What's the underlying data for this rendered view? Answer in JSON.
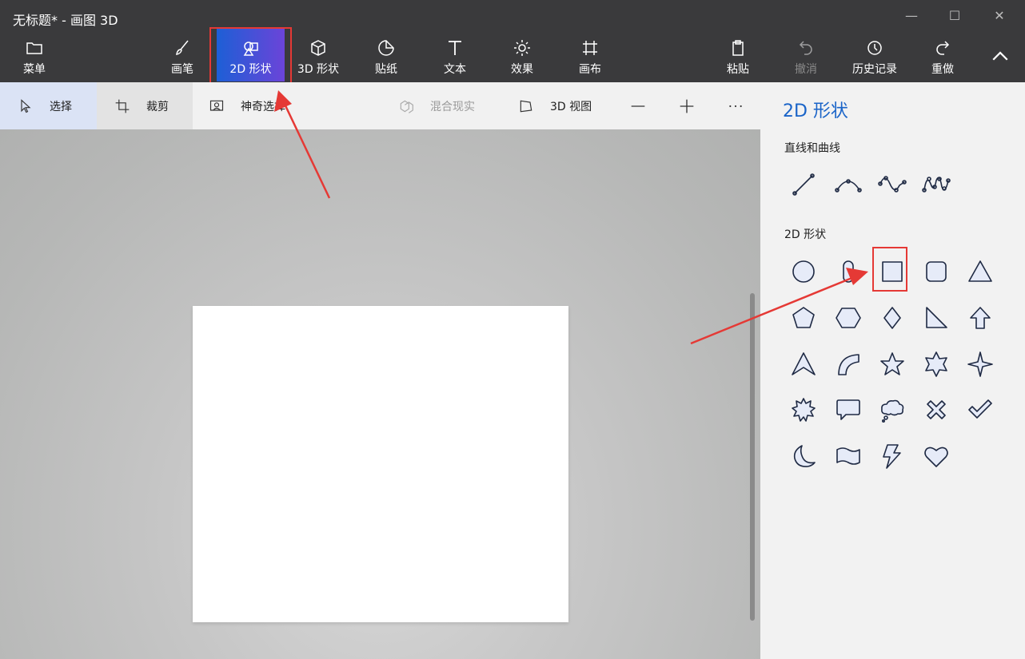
{
  "window": {
    "title": "无标题* - 画图 3D"
  },
  "ribbon": {
    "menu": "菜单",
    "brushes": "画笔",
    "shapes2d": "2D 形状",
    "shapes3d": "3D 形状",
    "stickers": "贴纸",
    "text": "文本",
    "effects": "效果",
    "canvas": "画布",
    "paste": "粘贴",
    "undo": "撤消",
    "history": "历史记录",
    "redo": "重做"
  },
  "toolbar": {
    "select": "选择",
    "crop": "裁剪",
    "magic_select": "神奇选择",
    "mixed_reality": "混合现实",
    "view3d": "3D 视图"
  },
  "panel": {
    "title": "2D 形状",
    "lines_section": "直线和曲线",
    "shapes_section": "2D 形状"
  },
  "colors": {
    "accent": "#1a64c8",
    "annotation": "#e53935",
    "ribbon_bg": "#3a3a3c"
  }
}
